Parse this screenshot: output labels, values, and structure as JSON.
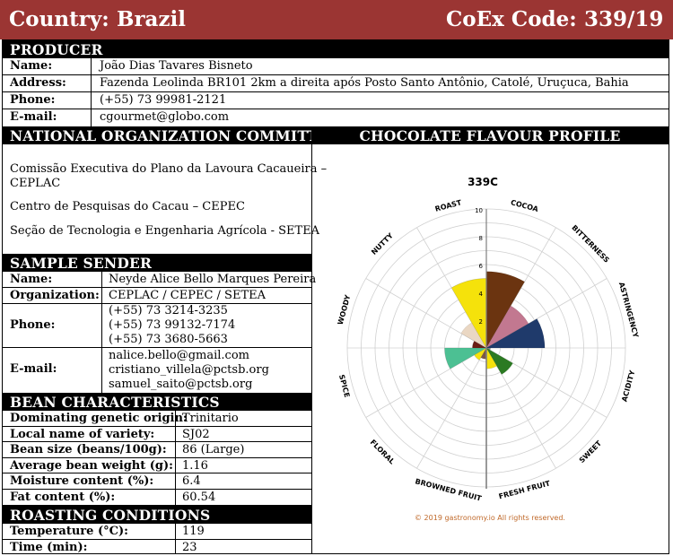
{
  "header": {
    "country_label": "Country:",
    "country": "Brazil",
    "coex_label": "CoEx Code:",
    "coex_code": "339/19"
  },
  "producer": {
    "title": "PRODUCER",
    "name_label": "Name:",
    "name": "João Dias Tavares Bisneto",
    "address_label": "Address:",
    "address": "Fazenda Leolinda BR101 2km a direita após Posto Santo Antônio, Catolé, Uruçuca, Bahia",
    "phone_label": "Phone:",
    "phone": "(+55) 73 99981-2121",
    "email_label": "E-mail:",
    "email": "cgourmet@globo.com"
  },
  "committee": {
    "title": "NATIONAL ORGANIZATION COMMITTEE",
    "lines": [
      "Comissão Executiva do Plano da Lavoura Cacaueira –",
      "CEPLAC",
      "Centro de Pesquisas do Cacau – CEPEC",
      "Seção de Tecnologia e Engenharia Agrícola - SETEA"
    ]
  },
  "sample_sender": {
    "title": "SAMPLE SENDER",
    "name_label": "Name:",
    "name": "Neyde Alice Bello Marques Pereira",
    "org_label": "Organization:",
    "org": "CEPLAC / CEPEC / SETEA",
    "phone_label": "Phone:",
    "phones": [
      "(+55) 73 3214-3235",
      "(+55) 73 99132-7174",
      "(+55) 73 3680-5663"
    ],
    "email_label": "E-mail:",
    "emails": [
      "nalice.bello@gmail.com",
      "cristiano_villela@pctsb.org",
      "samuel_saito@pctsb.org"
    ]
  },
  "bean": {
    "title": "BEAN CHARACTERISTICS",
    "rows": [
      {
        "label": "Dominating genetic origin:",
        "value": "Trinitario"
      },
      {
        "label": "Local name of variety:",
        "value": "SJ02"
      },
      {
        "label": "Bean size (beans/100g):",
        "value": "86 (Large)"
      },
      {
        "label": "Average bean weight (g):",
        "value": "1.16"
      },
      {
        "label": "Moisture content (%):",
        "value": "6.4"
      },
      {
        "label": "Fat content (%):",
        "value": "60.54"
      }
    ]
  },
  "roasting": {
    "title": "ROASTING CONDITIONS",
    "rows": [
      {
        "label": "Temperature (°C):",
        "value": "119"
      },
      {
        "label": "Time (min):",
        "value": "23"
      }
    ]
  },
  "profile": {
    "title": "CHOCOLATE FLAVOUR PROFILE",
    "copyright": "© 2019 gastronomy.io All rights reserved."
  },
  "chart_data": {
    "type": "polar-bar",
    "title": "339C",
    "r_ticks": [
      "2",
      "4",
      "6",
      "8",
      "10"
    ],
    "rlim": [
      0,
      10
    ],
    "grid": true,
    "categories": [
      "COCOA",
      "BITTERNESS",
      "ASTRINGENCY",
      "ACIDITY",
      "SWEET",
      "FRESH FRUIT",
      "BROWNED FRUIT",
      "FLORAL",
      "SPICE",
      "WOODY",
      "NUTTY",
      "ROAST"
    ],
    "values": [
      5.5,
      3.5,
      4.2,
      0.3,
      2.2,
      1.5,
      0.8,
      1.0,
      3.0,
      1.0,
      2.1,
      5.0
    ],
    "colors": [
      "#6b3410",
      "#c27890",
      "#1f3a6b",
      "#888888",
      "#2b7a22",
      "#f5e20b",
      "#7a5846",
      "#f5e20b",
      "#4cc093",
      "#6b1e14",
      "#ead7c3",
      "#f5e20b"
    ],
    "highlight_category": "BROWNED FRUIT"
  }
}
